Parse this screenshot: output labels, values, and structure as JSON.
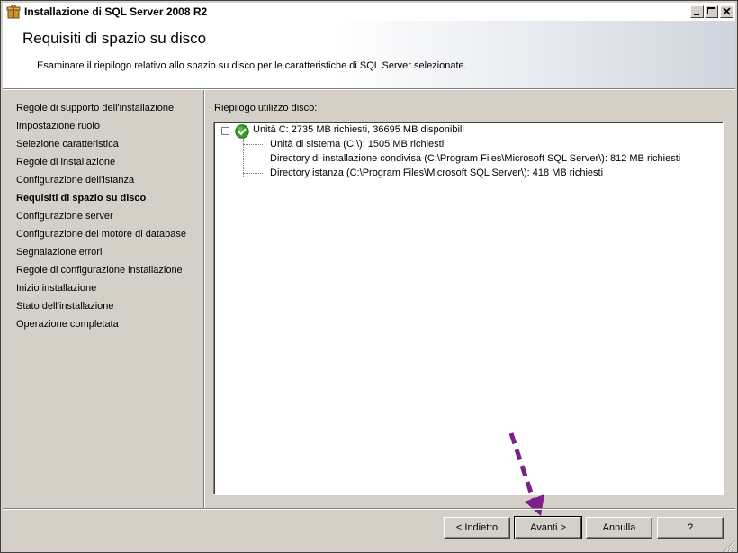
{
  "window": {
    "title": "Installazione di SQL Server 2008 R2"
  },
  "header": {
    "title": "Requisiti di spazio su disco",
    "subtitle": "Esaminare il riepilogo relativo allo spazio su disco per le caratteristiche di SQL Server selezionate."
  },
  "sidebar": {
    "items": [
      {
        "label": "Regole di supporto dell'installazione"
      },
      {
        "label": "Impostazione ruolo"
      },
      {
        "label": "Selezione caratteristica"
      },
      {
        "label": "Regole di installazione"
      },
      {
        "label": "Configurazione dell'istanza"
      },
      {
        "label": "Requisiti di spazio su disco",
        "active": true
      },
      {
        "label": "Configurazione server"
      },
      {
        "label": "Configurazione del motore di database"
      },
      {
        "label": "Segnalazione errori"
      },
      {
        "label": "Regole di configurazione installazione"
      },
      {
        "label": "Inizio installazione"
      },
      {
        "label": "Stato dell'installazione"
      },
      {
        "label": "Operazione completata"
      }
    ]
  },
  "main": {
    "summary_label": "Riepilogo utilizzo disco:",
    "tree": {
      "root": "Unità C: 2735 MB richiesti, 36695 MB disponibili",
      "root_icon": "check-circle-icon",
      "children": [
        "Unità di sistema (C:\\): 1505 MB richiesti",
        "Directory di installazione condivisa (C:\\Program Files\\Microsoft SQL Server\\): 812 MB richiesti",
        "Directory istanza (C:\\Program Files\\Microsoft SQL Server\\): 418 MB richiesti"
      ]
    }
  },
  "buttons": {
    "back": "< Indietro",
    "next": "Avanti >",
    "cancel": "Annulla",
    "help": "?"
  },
  "colors": {
    "annotation_arrow": "#7b1f8a",
    "check_green": "#3a9a2a"
  }
}
